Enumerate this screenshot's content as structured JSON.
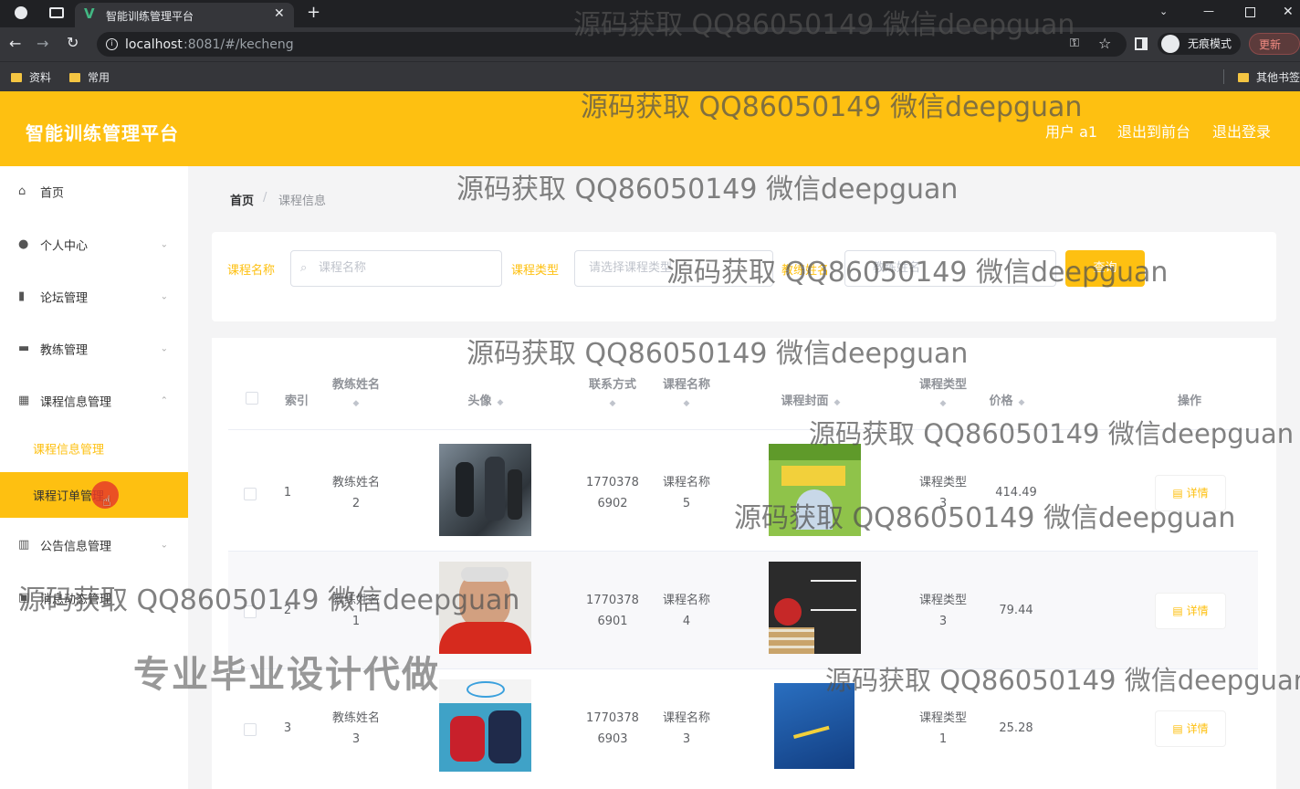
{
  "browser": {
    "tab_title": "智能训练管理平台",
    "url_host": "localhost",
    "url_rest": ":8081/#/kecheng",
    "incognito_label": "无痕模式",
    "update_label": "更新",
    "bookmarks": [
      "资料",
      "常用"
    ],
    "other_bookmarks": "其他书签"
  },
  "header": {
    "brand": "智能训练管理平台",
    "user": "用户 a1",
    "to_front": "退出到前台",
    "logout": "退出登录"
  },
  "sidebar": {
    "items": [
      {
        "label": "首页",
        "icon": "home-icon"
      },
      {
        "label": "个人中心",
        "icon": "user-icon"
      },
      {
        "label": "论坛管理",
        "icon": "bar-chart-icon"
      },
      {
        "label": "教练管理",
        "icon": "briefcase-icon"
      },
      {
        "label": "课程信息管理",
        "icon": "table-icon"
      },
      {
        "label": "公告信息管理",
        "icon": "books-icon"
      },
      {
        "label": "消息动态管理",
        "icon": "message-icon"
      }
    ],
    "sub_items": [
      "课程信息管理",
      "课程订单管理"
    ]
  },
  "breadcrumb": {
    "home": "首页",
    "sep": "/",
    "current": "课程信息"
  },
  "search": {
    "name_label": "课程名称",
    "name_placeholder": "课程名称",
    "type_label": "课程类型",
    "type_placeholder": "请选择课程类型",
    "third_label": "教练姓名",
    "third_placeholder": "教练姓名",
    "button": "查询"
  },
  "table": {
    "headers": {
      "index": "索引",
      "coach": "教练姓名",
      "avatar": "头像",
      "phone": "联系方式",
      "course": "课程名称",
      "cover": "课程封面",
      "type": "课程类型",
      "price": "价格",
      "action": "操作"
    },
    "detail_label": "详情",
    "rows": [
      {
        "index": "1",
        "coach": "教练姓名",
        "coach_no": "2",
        "phone_a": "1770378",
        "phone_b": "6902",
        "course": "课程名称",
        "course_no": "5",
        "type": "课程类型",
        "type_no": "3",
        "price": "414.49"
      },
      {
        "index": "2",
        "coach": "教练姓名",
        "coach_no": "1",
        "phone_a": "1770378",
        "phone_b": "6901",
        "course": "课程名称",
        "course_no": "4",
        "type": "课程类型",
        "type_no": "3",
        "price": "79.44"
      },
      {
        "index": "3",
        "coach": "教练姓名",
        "coach_no": "3",
        "phone_a": "1770378",
        "phone_b": "6903",
        "course": "课程名称",
        "course_no": "3",
        "type": "课程类型",
        "type_no": "1",
        "price": "25.28"
      }
    ]
  },
  "watermark": {
    "text": "源码获取 QQ86050149 微信deepguan",
    "big_text": "专业毕业设计代做"
  },
  "colors": {
    "accent": "#fec011"
  }
}
